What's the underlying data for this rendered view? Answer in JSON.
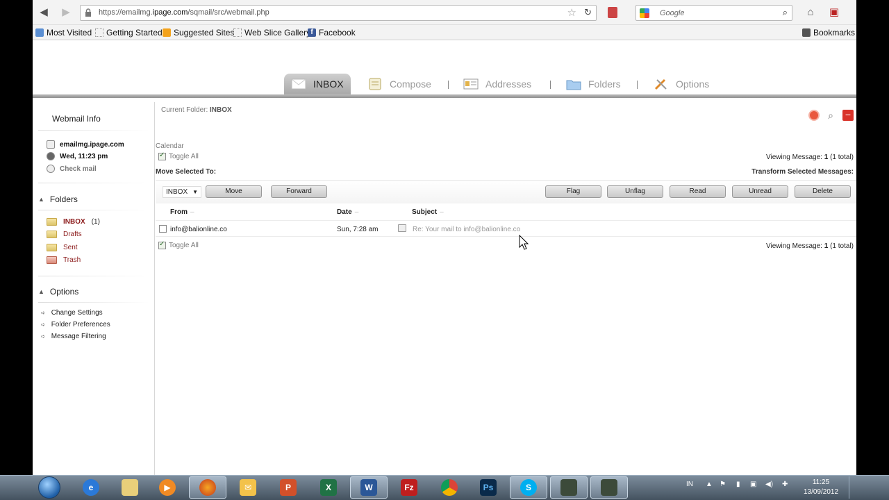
{
  "browser": {
    "url_prefix": "https://emailmg.",
    "url_domain": "ipage.com",
    "url_path": "/sqmail/src/webmail.php",
    "search_placeholder": "Google"
  },
  "bookmarks": {
    "items": [
      "Most Visited",
      "Getting Started",
      "Suggested Sites",
      "Web Slice Gallery",
      "Facebook"
    ],
    "bookmarks_label": "Bookmarks"
  },
  "tabs": [
    {
      "label": "INBOX",
      "active": true
    },
    {
      "label": "Compose",
      "active": false
    },
    {
      "label": "Addresses",
      "active": false
    },
    {
      "label": "Folders",
      "active": false
    },
    {
      "label": "Options",
      "active": false
    }
  ],
  "sidebar": {
    "title": "Webmail Info",
    "host": "emailmg.ipage.com",
    "datetime": "Wed, 11:23 pm",
    "check_mail": "Check mail",
    "folders_heading": "Folders",
    "folders": [
      {
        "name": "INBOX",
        "count": "(1)"
      },
      {
        "name": "Drafts"
      },
      {
        "name": "Sent"
      },
      {
        "name": "Trash"
      }
    ],
    "options_heading": "Options",
    "options": [
      "Change Settings",
      "Folder Preferences",
      "Message Filtering"
    ]
  },
  "main": {
    "current_folder_label": "Current Folder:",
    "current_folder": "INBOX",
    "calendar": "Calendar",
    "toggle_all": "Toggle All",
    "viewing_prefix": "Viewing Message:",
    "viewing_num": "1",
    "viewing_total": "(1 total)",
    "move_selected": "Move Selected To:",
    "transform_selected": "Transform Selected Messages:",
    "folder_select": "INBOX",
    "buttons": {
      "move": "Move",
      "forward": "Forward",
      "flag": "Flag",
      "unflag": "Unflag",
      "read": "Read",
      "unread": "Unread",
      "delete": "Delete"
    },
    "columns": {
      "from": "From",
      "date": "Date",
      "subject": "Subject"
    },
    "messages": [
      {
        "from": "info@balionline.co",
        "date": "Sun, 7:28 am",
        "subject": "Re: Your mail to info@balionline.co"
      }
    ]
  },
  "taskbar": {
    "lang": "IN",
    "time": "11:25",
    "date": "13/09/2012"
  }
}
